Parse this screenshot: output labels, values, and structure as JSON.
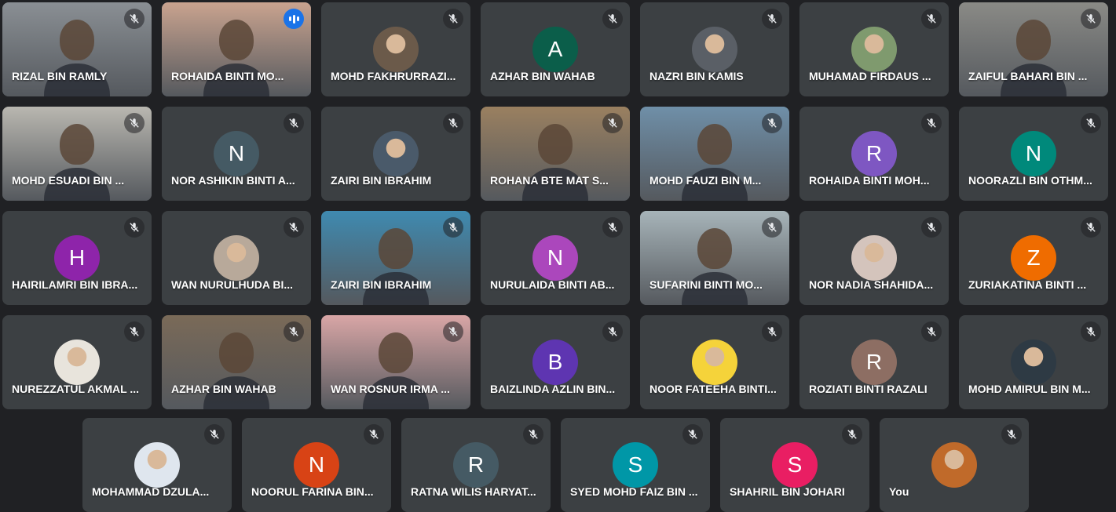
{
  "participants": [
    {
      "name": "RIZAL BIN RAMLY",
      "type": "video",
      "bg": "#8a8f94",
      "speaking": false
    },
    {
      "name": "ROHAIDA BINTI MO...",
      "type": "video",
      "bg": "#c9a38f",
      "speaking": true
    },
    {
      "name": "MOHD FAKHRURRAZI...",
      "type": "photo",
      "bg": "#6b5a4a",
      "speaking": false
    },
    {
      "name": "AZHAR BIN WAHAB",
      "type": "letter",
      "letter": "A",
      "color": "#0b5e4a",
      "speaking": false
    },
    {
      "name": "NAZRI BIN KAMIS",
      "type": "photo",
      "bg": "#5a5f66",
      "speaking": false
    },
    {
      "name": "MUHAMAD FIRDAUS ...",
      "type": "photo",
      "bg": "#7f9a6e",
      "speaking": false
    },
    {
      "name": "ZAIFUL BAHARI BIN ...",
      "type": "video",
      "bg": "#8a8a86",
      "speaking": false
    },
    {
      "name": "MOHD ESUADI BIN ...",
      "type": "video",
      "bg": "#b9b7b0",
      "speaking": false
    },
    {
      "name": "NOR ASHIKIN BINTI A...",
      "type": "letter",
      "letter": "N",
      "color": "#455a64",
      "speaking": false
    },
    {
      "name": "ZAIRI BIN IBRAHIM",
      "type": "photo",
      "bg": "#4a5a6a",
      "speaking": false
    },
    {
      "name": "ROHANA BTE MAT S...",
      "type": "video",
      "bg": "#9a8060",
      "speaking": false
    },
    {
      "name": "MOHD FAUZI BIN M...",
      "type": "video",
      "bg": "#6f8fa8",
      "speaking": false
    },
    {
      "name": "ROHAIDA BINTI MOH...",
      "type": "letter",
      "letter": "R",
      "color": "#7e57c2",
      "speaking": false
    },
    {
      "name": "NOORAZLI BIN OTHM...",
      "type": "letter",
      "letter": "N",
      "color": "#00897b",
      "speaking": false
    },
    {
      "name": "HAIRILAMRI BIN IBRA...",
      "type": "letter",
      "letter": "H",
      "color": "#8e24aa",
      "speaking": false
    },
    {
      "name": "WAN NURULHUDA BI...",
      "type": "photo",
      "bg": "#b8a99a",
      "speaking": false
    },
    {
      "name": "ZAIRI BIN IBRAHIM",
      "type": "video",
      "bg": "#3f8ab0",
      "speaking": false
    },
    {
      "name": "NURULAIDA BINTI AB...",
      "type": "letter",
      "letter": "N",
      "color": "#ab47bc",
      "speaking": false
    },
    {
      "name": "SUFARINI BINTI MO...",
      "type": "video",
      "bg": "#a7b4b9",
      "speaking": false
    },
    {
      "name": "NOR NADIA SHAHIDA...",
      "type": "photo",
      "bg": "#d4c4bc",
      "speaking": false
    },
    {
      "name": "ZURIAKATINA BINTI ...",
      "type": "letter",
      "letter": "Z",
      "color": "#ef6c00",
      "speaking": false
    },
    {
      "name": "NUREZZATUL AKMAL ...",
      "type": "photo",
      "bg": "#e8e4dc",
      "speaking": false
    },
    {
      "name": "AZHAR BIN WAHAB",
      "type": "video",
      "bg": "#7a6a58",
      "speaking": false
    },
    {
      "name": "WAN ROSNUR IRMA ...",
      "type": "video",
      "bg": "#d9a6a6",
      "speaking": false
    },
    {
      "name": "BAIZLINDA AZLIN BIN...",
      "type": "letter",
      "letter": "B",
      "color": "#5e35b1",
      "speaking": false
    },
    {
      "name": "NOOR FATEEHA BINTI...",
      "type": "photo",
      "bg": "#f5d33a",
      "speaking": false
    },
    {
      "name": "ROZIATI BINTI RAZALI",
      "type": "letter",
      "letter": "R",
      "color": "#8d6e63",
      "speaking": false
    },
    {
      "name": "MOHD AMIRUL BIN M...",
      "type": "photo",
      "bg": "#2e3a44",
      "speaking": false
    }
  ],
  "last_row": [
    {
      "name": "MOHAMMAD DZULA...",
      "type": "photo",
      "bg": "#dfe6ee",
      "speaking": false
    },
    {
      "name": "NOORUL FARINA BIN...",
      "type": "letter",
      "letter": "N",
      "color": "#d84315",
      "speaking": false
    },
    {
      "name": "RATNA WILIS HARYAT...",
      "type": "letter",
      "letter": "R",
      "color": "#455a64",
      "speaking": false
    },
    {
      "name": "SYED MOHD FAIZ BIN ...",
      "type": "letter",
      "letter": "S",
      "color": "#0097a7",
      "speaking": false
    },
    {
      "name": "SHAHRIL BIN JOHARI",
      "type": "letter",
      "letter": "S",
      "color": "#e91e63",
      "speaking": false
    },
    {
      "name": "You",
      "type": "photo",
      "bg": "#c06a2a",
      "speaking": false
    }
  ],
  "icons": {
    "muted": "mic-off-icon",
    "speaking": "speaking-indicator-icon"
  },
  "colors": {
    "background": "#202124",
    "tile": "#3c4043",
    "speaking_border": "#8ab4f8"
  }
}
